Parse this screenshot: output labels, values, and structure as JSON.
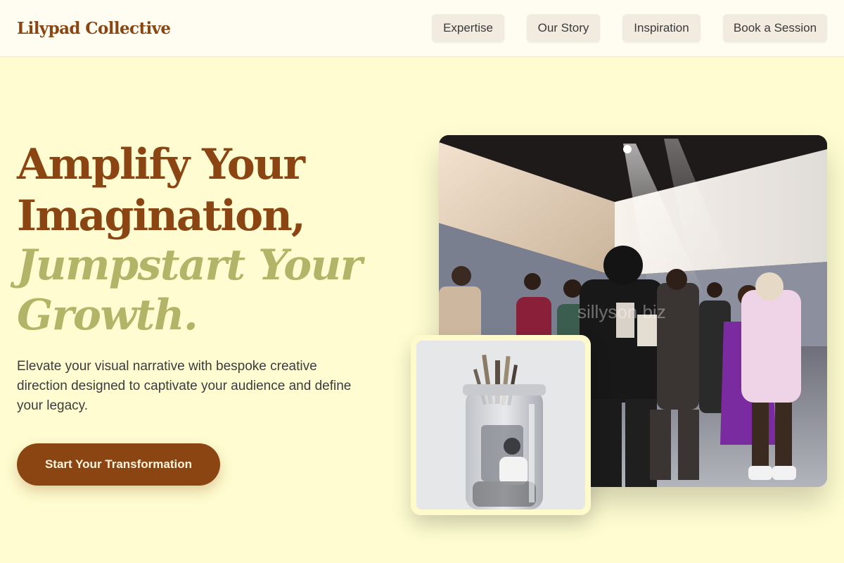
{
  "header": {
    "brand": "Lilypad Collective",
    "nav": [
      "Expertise",
      "Our Story",
      "Inspiration",
      "Book a Session"
    ]
  },
  "hero": {
    "title_lines": [
      "Amplify Your",
      "Imagination,"
    ],
    "accent_lines": [
      "Jumpstart Your",
      "Growth."
    ],
    "description": "Elevate your visual narrative with bespoke creative direction designed to captivate your audience and define your legacy.",
    "cta_label": "Start Your Transformation"
  },
  "main_image": {
    "watermark": "sillyson biz"
  },
  "colors": {
    "background": "#fefcd0",
    "brand_brown": "#8b4513",
    "accent_olive": "#b4b468",
    "nav_button": "#f2ebe0"
  }
}
